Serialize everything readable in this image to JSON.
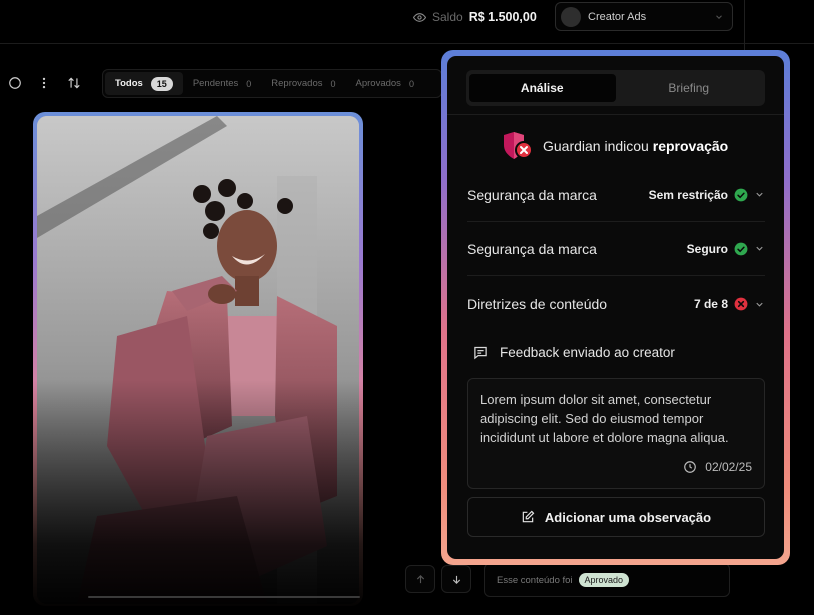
{
  "header": {
    "balance_label": "Saldo",
    "balance_value": "R$ 1.500,00",
    "account_name": "Creator Ads"
  },
  "filters": [
    {
      "label": "Todos",
      "count": "15",
      "active": true
    },
    {
      "label": "Pendentes",
      "count": "0"
    },
    {
      "label": "Reprovados",
      "count": "0"
    },
    {
      "label": "Aprovados",
      "count": "0"
    }
  ],
  "panel": {
    "tabs": [
      "Análise",
      "Briefing"
    ],
    "guardian_prefix": "Guardian indicou",
    "guardian_result": "reprovação",
    "checks": [
      {
        "label": "Segurança da marca",
        "value": "Sem restrição",
        "status": "ok"
      },
      {
        "label": "Segurança da marca",
        "value": "Seguro",
        "status": "ok"
      },
      {
        "label": "Diretrizes de conteúdo",
        "value": "7 de 8",
        "status": "fail"
      }
    ],
    "feedback_title": "Feedback enviado ao creator",
    "feedback_text": "Lorem ipsum dolor sit amet, consectetur adipiscing elit. Sed do eiusmod tempor incididunt ut labore et dolore magna aliqua.",
    "feedback_date": "02/02/25",
    "add_note_label": "Adicionar uma observação"
  },
  "footer": {
    "status_text": "Esse conteúdo foi",
    "status_badge": "Aprovado"
  },
  "colors": {
    "ok": "#2fa84f",
    "fail": "#e0313f",
    "shield": "#c2185b",
    "accent_blue": "#5c7fd8",
    "accent_pink": "#f08d7d"
  }
}
